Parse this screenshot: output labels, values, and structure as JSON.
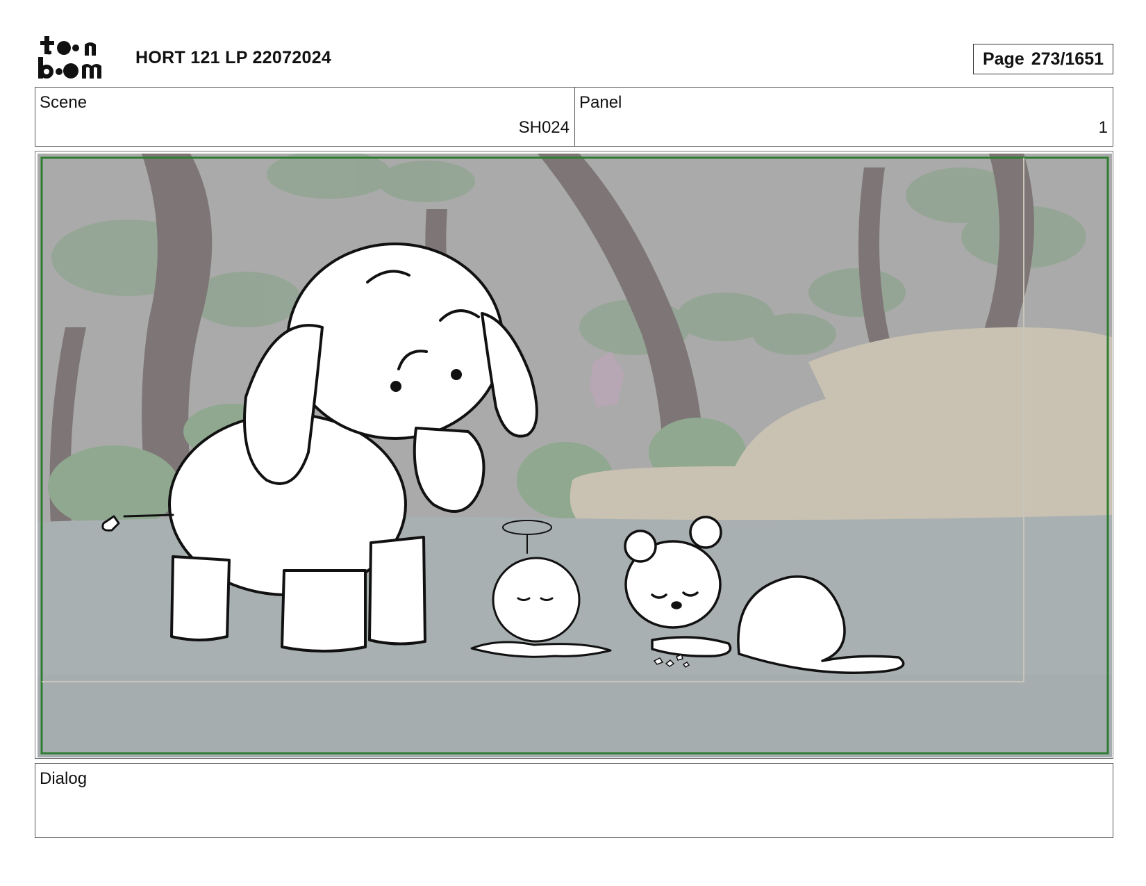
{
  "header": {
    "logo_text": "toon boom",
    "title": "HORT 121 LP 22072024",
    "page_label": "Page",
    "page_value": "273/1651"
  },
  "scene": {
    "label": "Scene",
    "value": "SH024"
  },
  "panel": {
    "label": "Panel",
    "value": "1"
  },
  "artwork": {
    "safe_frame_color": "#2e7d32",
    "background": "jungle clearing with trees, foliage and sandy rocks",
    "characters": [
      "elephant",
      "small round creature with halo",
      "bear cub"
    ]
  },
  "dialog": {
    "label": "Dialog",
    "text": ""
  }
}
